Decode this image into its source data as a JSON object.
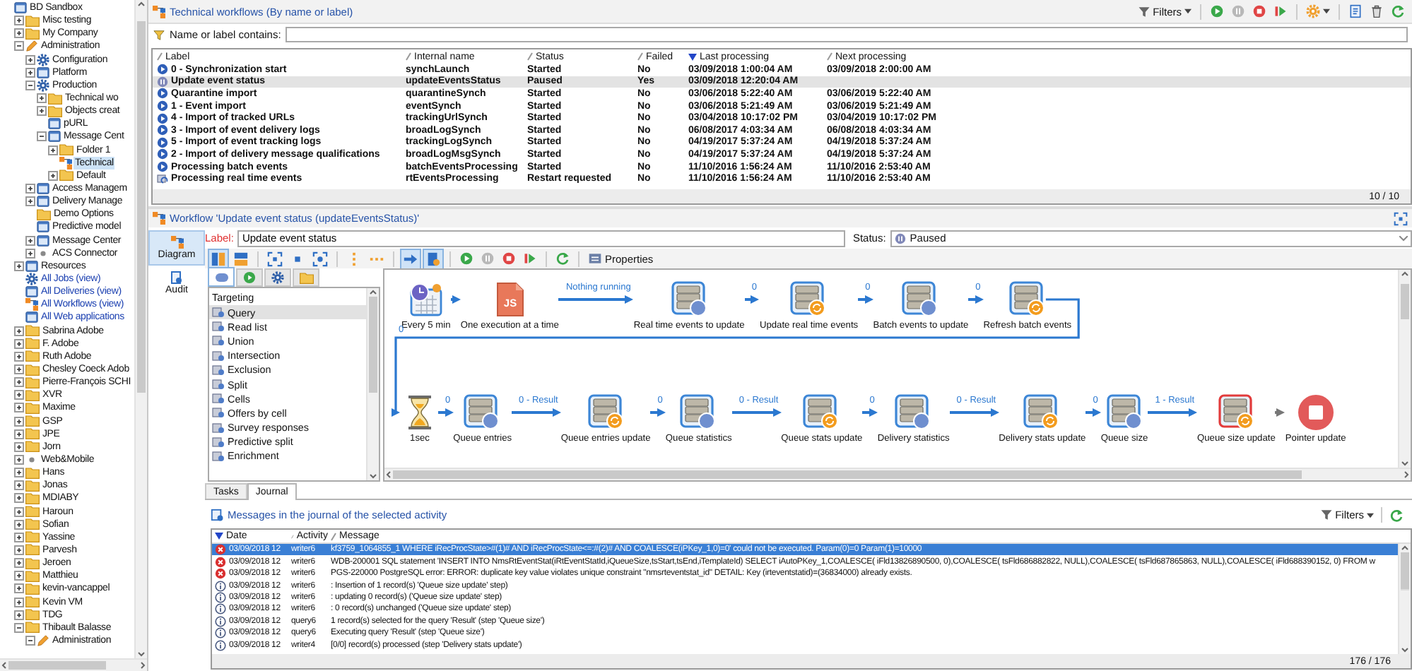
{
  "tree": [
    {
      "label": "BD Sandbox",
      "kind": "app",
      "link": false,
      "selected": false,
      "children": [
        {
          "label": "Misc testing",
          "kind": "folder",
          "link": false,
          "selected": false,
          "expanded": false
        },
        {
          "label": "My Company",
          "kind": "folder",
          "link": false,
          "selected": false,
          "expanded": false
        },
        {
          "label": "Administration",
          "kind": "pencil",
          "link": false,
          "selected": false,
          "expanded": true,
          "children": [
            {
              "label": "Configuration",
              "kind": "gear",
              "link": false,
              "selected": false,
              "expanded": false
            },
            {
              "label": "Platform",
              "kind": "app",
              "link": false,
              "selected": false,
              "expanded": false
            },
            {
              "label": "Production",
              "kind": "gear",
              "link": false,
              "selected": false,
              "expanded": true,
              "children": [
                {
                  "label": "Technical wo",
                  "kind": "folder",
                  "link": false,
                  "selected": false,
                  "expanded": false
                },
                {
                  "label": "Objects creat",
                  "kind": "folder",
                  "link": false,
                  "selected": false,
                  "expanded": false
                },
                {
                  "label": "pURL",
                  "kind": "app",
                  "link": false,
                  "selected": false
                },
                {
                  "label": "Message Cent",
                  "kind": "app",
                  "link": false,
                  "selected": false,
                  "expanded": true,
                  "children": [
                    {
                      "label": "Folder 1",
                      "kind": "folder",
                      "link": false,
                      "selected": false,
                      "expanded": false
                    },
                    {
                      "label": "Technical",
                      "kind": "workflow",
                      "link": false,
                      "selected": true
                    },
                    {
                      "label": "Default",
                      "kind": "folder",
                      "link": false,
                      "selected": false,
                      "expanded": false
                    }
                  ]
                }
              ]
            },
            {
              "label": "Access Managem",
              "kind": "app",
              "link": false,
              "selected": false,
              "expanded": false
            },
            {
              "label": "Delivery Manage",
              "kind": "app",
              "link": false,
              "selected": false,
              "expanded": false
            },
            {
              "label": "Demo Options",
              "kind": "folder",
              "link": false,
              "selected": false
            },
            {
              "label": "Predictive model",
              "kind": "app",
              "link": false,
              "selected": false
            },
            {
              "label": "Message Center",
              "kind": "app",
              "link": false,
              "selected": false,
              "expanded": false
            },
            {
              "label": "ACS Connector",
              "kind": "dot",
              "link": false,
              "selected": false,
              "expanded": false
            }
          ]
        },
        {
          "label": "Resources",
          "kind": "app",
          "link": false,
          "selected": false,
          "expanded": false
        },
        {
          "label": "All Jobs (view)",
          "kind": "gear",
          "link": true,
          "selected": false
        },
        {
          "label": "All Deliveries (view)",
          "kind": "app",
          "link": true,
          "selected": false
        },
        {
          "label": "All Workflows (view)",
          "kind": "workflow",
          "link": true,
          "selected": false
        },
        {
          "label": "All Web applications",
          "kind": "app",
          "link": true,
          "selected": false
        },
        {
          "label": "Sabrina Adobe",
          "kind": "folder",
          "link": false,
          "selected": false,
          "expanded": false
        },
        {
          "label": "F. Adobe",
          "kind": "folder",
          "link": false,
          "selected": false,
          "expanded": false
        },
        {
          "label": "Ruth Adobe",
          "kind": "folder",
          "link": false,
          "selected": false,
          "expanded": false
        },
        {
          "label": "Chesley Coeck Adob",
          "kind": "folder",
          "link": false,
          "selected": false,
          "expanded": false
        },
        {
          "label": "Pierre-François SCHI",
          "kind": "folder",
          "link": false,
          "selected": false,
          "expanded": false
        },
        {
          "label": "XVR",
          "kind": "folder",
          "link": false,
          "selected": false,
          "expanded": false
        },
        {
          "label": "Maxime",
          "kind": "folder",
          "link": false,
          "selected": false,
          "expanded": false
        },
        {
          "label": "GSP",
          "kind": "folder",
          "link": false,
          "selected": false,
          "expanded": false
        },
        {
          "label": "JPE",
          "kind": "folder",
          "link": false,
          "selected": false,
          "expanded": false
        },
        {
          "label": "Jorn",
          "kind": "folder",
          "link": false,
          "selected": false,
          "expanded": false
        },
        {
          "label": "Web&Mobile",
          "kind": "dot",
          "link": false,
          "selected": false,
          "expanded": false
        },
        {
          "label": "Hans",
          "kind": "folder",
          "link": false,
          "selected": false,
          "expanded": false
        },
        {
          "label": "Jonas",
          "kind": "folder",
          "link": false,
          "selected": false,
          "expanded": false
        },
        {
          "label": "MDIABY",
          "kind": "folder",
          "link": false,
          "selected": false,
          "expanded": false
        },
        {
          "label": "Haroun",
          "kind": "folder",
          "link": false,
          "selected": false,
          "expanded": false
        },
        {
          "label": "Sofian",
          "kind": "folder",
          "link": false,
          "selected": false,
          "expanded": false
        },
        {
          "label": "Yassine",
          "kind": "folder",
          "link": false,
          "selected": false,
          "expanded": false
        },
        {
          "label": "Parvesh",
          "kind": "folder",
          "link": false,
          "selected": false,
          "expanded": false
        },
        {
          "label": "Jeroen",
          "kind": "folder",
          "link": false,
          "selected": false,
          "expanded": false
        },
        {
          "label": "Matthieu",
          "kind": "folder",
          "link": false,
          "selected": false,
          "expanded": false
        },
        {
          "label": "kevin-vancappel",
          "kind": "folder",
          "link": false,
          "selected": false,
          "expanded": false
        },
        {
          "label": "Kevin VM",
          "kind": "folder",
          "link": false,
          "selected": false,
          "expanded": false
        },
        {
          "label": "TDG",
          "kind": "folder",
          "link": false,
          "selected": false,
          "expanded": false
        },
        {
          "label": "Thibault Balasse",
          "kind": "folder",
          "link": false,
          "selected": false,
          "expanded": true,
          "children": [
            {
              "label": "Administration",
              "kind": "pencil",
              "link": false,
              "selected": false,
              "expanded": true
            }
          ]
        }
      ]
    }
  ],
  "workflows": {
    "title": "Technical workflows (By name or label)",
    "toolbar": [
      [
        {
          "kind": "filters",
          "label": "Filters"
        }
      ],
      [
        {
          "kind": "start"
        },
        {
          "kind": "pause"
        },
        {
          "kind": "stop"
        },
        {
          "kind": "resume"
        }
      ],
      [
        {
          "kind": "actions"
        }
      ],
      [
        {
          "kind": "export"
        },
        {
          "kind": "delete"
        },
        {
          "kind": "refresh"
        }
      ]
    ],
    "filter_label": "Name or label contains:",
    "columns": [
      {
        "label": "Label",
        "sorted": false
      },
      {
        "label": "Internal name",
        "sorted": false
      },
      {
        "label": "Status",
        "sorted": false
      },
      {
        "label": "Failed",
        "sorted": false
      },
      {
        "label": "Last processing",
        "sorted": true
      },
      {
        "label": "Next processing",
        "sorted": false
      }
    ],
    "rows": [
      {
        "kind": "started",
        "selected": false,
        "cells": [
          "0 - Synchronization start",
          "synchLaunch",
          "Started",
          "No",
          "03/09/2018 1:00:04 AM",
          "03/09/2018 2:00:00 AM"
        ]
      },
      {
        "kind": "paused",
        "selected": true,
        "cells": [
          "Update event status",
          "updateEventsStatus",
          "Paused",
          "Yes",
          "03/09/2018 12:20:04 AM"
        ]
      },
      {
        "kind": "started",
        "selected": false,
        "cells": [
          "Quarantine import",
          "quarantineSynch",
          "Started",
          "No",
          "03/06/2018 5:22:40 AM",
          "03/06/2019 5:22:40 AM"
        ]
      },
      {
        "kind": "started",
        "selected": false,
        "cells": [
          "1 - Event import",
          "eventSynch",
          "Started",
          "No",
          "03/06/2018 5:21:49 AM",
          "03/06/2019 5:21:49 AM"
        ]
      },
      {
        "kind": "started",
        "selected": false,
        "cells": [
          "4 - Import of tracked URLs",
          "trackingUrlSynch",
          "Started",
          "No",
          "03/04/2018 10:17:02 PM",
          "03/04/2019 10:17:02 PM"
        ]
      },
      {
        "kind": "started",
        "selected": false,
        "cells": [
          "3 - Import of event delivery logs",
          "broadLogSynch",
          "Started",
          "No",
          "06/08/2017 4:03:34 AM",
          "06/08/2018 4:03:34 AM"
        ]
      },
      {
        "kind": "started",
        "selected": false,
        "cells": [
          "5 - Import of event tracking logs",
          "trackingLogSynch",
          "Started",
          "No",
          "04/19/2017 5:37:24 AM",
          "04/19/2018 5:37:24 AM"
        ]
      },
      {
        "kind": "started",
        "selected": false,
        "cells": [
          "2 - Import of delivery message qualifications",
          "broadLogMsgSynch",
          "Started",
          "No",
          "04/19/2017 5:37:24 AM",
          "04/19/2018 5:37:24 AM"
        ]
      },
      {
        "kind": "started",
        "selected": false,
        "cells": [
          "Processing batch events",
          "batchEventsProcessing",
          "Started",
          "No",
          "11/10/2016 1:56:24 AM",
          "11/10/2016 2:53:40 AM"
        ]
      },
      {
        "kind": "restart",
        "selected": false,
        "cells": [
          "Processing real time events",
          "rtEventsProcessing",
          "Restart requested",
          "No",
          "11/10/2016 1:56:24 AM",
          "11/10/2016 2:53:40 AM"
        ]
      }
    ],
    "count": "10 / 10"
  },
  "editor": {
    "title": "Workflow 'Update event status (updateEventsStatus)'",
    "side_tabs": [
      {
        "label": "Diagram",
        "kind": "diagram",
        "selected": true
      },
      {
        "label": "Audit",
        "kind": "audit",
        "selected": false
      }
    ],
    "label_caption": "Label:",
    "label_value": "Update event status",
    "status_caption": "Status:",
    "status": {
      "label": "Paused",
      "kind": "paused"
    },
    "toolbar": [
      [
        {
          "kind": "vlayout",
          "pressed": true
        },
        {
          "kind": "hlayout",
          "pressed": false
        }
      ],
      [
        {
          "kind": "fit",
          "pressed": false
        },
        {
          "kind": "center",
          "pressed": false
        },
        {
          "kind": "zoom",
          "pressed": false
        }
      ],
      [
        {
          "kind": "vdots",
          "pressed": false
        },
        {
          "kind": "hdots",
          "pressed": false
        }
      ],
      [
        {
          "kind": "arrow",
          "pressed": true
        },
        {
          "kind": "flag",
          "pressed": true
        }
      ],
      [
        {
          "kind": "start",
          "pressed": false
        },
        {
          "kind": "pause",
          "pressed": false
        },
        {
          "kind": "stop",
          "pressed": false
        },
        {
          "kind": "resume",
          "pressed": false
        }
      ],
      [
        {
          "kind": "refresh",
          "pressed": false
        }
      ],
      [
        {
          "kind": "properties",
          "label": "Properties",
          "pressed": false
        }
      ]
    ],
    "palette": {
      "tabs": [
        {
          "kind": "targeting",
          "selected": true
        },
        {
          "kind": "flow",
          "selected": false
        },
        {
          "kind": "actions",
          "selected": false
        },
        {
          "kind": "events",
          "selected": false
        }
      ],
      "group": "Targeting",
      "items": [
        {
          "label": "Query",
          "selected": true
        },
        {
          "label": "Read list",
          "selected": false
        },
        {
          "label": "Union",
          "selected": false
        },
        {
          "label": "Intersection",
          "selected": false
        },
        {
          "label": "Exclusion",
          "selected": false
        },
        {
          "label": "Split",
          "selected": false
        },
        {
          "label": "Cells",
          "selected": false
        },
        {
          "label": "Offers by cell",
          "selected": false
        },
        {
          "label": "Survey responses",
          "selected": false
        },
        {
          "label": "Predictive split",
          "selected": false
        },
        {
          "label": "Enrichment",
          "selected": false
        }
      ]
    },
    "diagram": {
      "rows": [
        {
          "nodes": [
            {
              "label": "Every 5 min",
              "kind": "scheduler",
              "error": false,
              "link": {
                "active": true
              }
            },
            {
              "label": "One execution at a time",
              "kind": "js",
              "badge": "JS",
              "error": false,
              "link": {
                "label": "Nothing running",
                "active": true
              }
            },
            {
              "label": "Real time events to update",
              "kind": "query",
              "error": false,
              "link": {
                "label": "0",
                "active": true
              }
            },
            {
              "label": "Update real time events",
              "kind": "update",
              "error": false,
              "link": {
                "label": "0",
                "active": true
              }
            },
            {
              "label": "Batch events to update",
              "kind": "query",
              "error": false,
              "link": {
                "label": "0",
                "active": true
              }
            },
            {
              "label": "Refresh batch events",
              "kind": "update",
              "error": false
            }
          ]
        },
        {
          "nodes": [
            {
              "label": "1sec",
              "kind": "wait",
              "error": false,
              "link": {
                "label": "0",
                "active": true
              }
            },
            {
              "label": "Queue entries",
              "kind": "query",
              "error": false,
              "link": {
                "label": "0 - Result",
                "active": true
              }
            },
            {
              "label": "Queue entries update",
              "kind": "update",
              "error": false,
              "link": {
                "label": "0",
                "active": true
              }
            },
            {
              "label": "Queue statistics",
              "kind": "query",
              "error": false,
              "link": {
                "label": "0 - Result",
                "active": true
              }
            },
            {
              "label": "Queue stats update",
              "kind": "update",
              "error": false,
              "link": {
                "label": "0",
                "active": true
              }
            },
            {
              "label": "Delivery statistics",
              "kind": "query",
              "error": false,
              "link": {
                "label": "0 - Result",
                "active": true
              }
            },
            {
              "label": "Delivery stats update",
              "kind": "update",
              "error": false,
              "link": {
                "label": "0",
                "active": true
              }
            },
            {
              "label": "Queue size",
              "kind": "query",
              "error": false,
              "link": {
                "label": "1 - Result",
                "active": true
              }
            },
            {
              "label": "Queue size update",
              "kind": "update",
              "error": true,
              "link": {
                "active": false
              }
            },
            {
              "label": "Pointer update",
              "kind": "end",
              "error": false
            }
          ]
        }
      ],
      "loop": {
        "label": "0",
        "active": true
      }
    }
  },
  "journal": {
    "tabs": [
      {
        "label": "Tasks",
        "selected": false
      },
      {
        "label": "Journal",
        "selected": true
      }
    ],
    "title": "Messages in the journal of the selected activity",
    "toolbar": [
      [
        {
          "kind": "filters",
          "label": "Filters"
        }
      ],
      [
        {
          "kind": "refresh"
        }
      ]
    ],
    "columns": [
      {
        "label": "Date",
        "sorted": true
      },
      {
        "label": "Activity",
        "sorted": false
      },
      {
        "label": "Message",
        "sorted": false
      }
    ],
    "rows": [
      {
        "kind": "error",
        "selected": true,
        "date": "03/09/2018 12",
        "activity": "writer6",
        "message": "kf3759_1064855_1 WHERE iRecProcState>#(1)# AND iRecProcState<=:#(2)# AND COALESCE(iPKey_1,0)=0' could not be executed.   Param(0)=0   Param(1)=10000"
      },
      {
        "kind": "error",
        "selected": false,
        "date": "03/09/2018 12",
        "activity": "writer6",
        "message": "WDB-200001 SQL statement 'INSERT INTO NmsRtEventStat(iRtEventStatId,iQueueSize,tsStart,tsEnd,iTemplateId) SELECT iAutoPKey_1,COALESCE( iFld13826890500, 0),COALESCE( tsFld686882822, NULL),COALESCE( tsFld687865863, NULL),COALESCE( iFld688390152, 0)  FROM w"
      },
      {
        "kind": "error",
        "selected": false,
        "date": "03/09/2018 12",
        "activity": "writer6",
        "message": "PGS-220000 PostgreSQL error: ERROR:  duplicate key value violates unique constraint \"nmsrteventstat_id\" DETAIL:  Key (irteventstatid)=(36834000) already exists."
      },
      {
        "kind": "info",
        "selected": false,
        "date": "03/09/2018 12",
        "activity": "writer6",
        "message": ": Insertion of 1 record(s) 'Queue size update' step)"
      },
      {
        "kind": "info",
        "selected": false,
        "date": "03/09/2018 12",
        "activity": "writer6",
        "message": ": updating 0 record(s) ('Queue size update' step)"
      },
      {
        "kind": "info",
        "selected": false,
        "date": "03/09/2018 12",
        "activity": "writer6",
        "message": ": 0 record(s) unchanged ('Queue size update' step)"
      },
      {
        "kind": "info",
        "selected": false,
        "date": "03/09/2018 12",
        "activity": "query6",
        "message": "1 record(s) selected for the query 'Result' (step 'Queue size')"
      },
      {
        "kind": "info",
        "selected": false,
        "date": "03/09/2018 12",
        "activity": "query6",
        "message": "Executing query 'Result' (step 'Queue size')"
      },
      {
        "kind": "info",
        "selected": false,
        "date": "03/09/2018 12",
        "activity": "writer4",
        "message": "[0/0] record(s) processed (step 'Delivery stats update')"
      }
    ],
    "count": "176 / 176"
  }
}
